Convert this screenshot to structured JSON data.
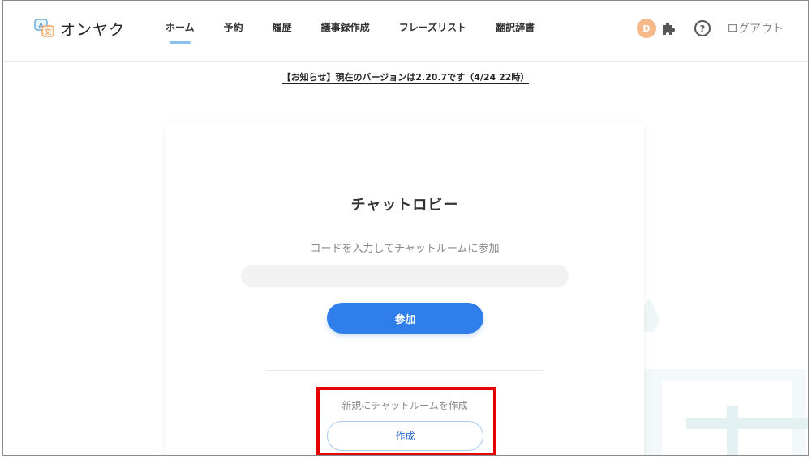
{
  "app": {
    "name": "オンヤク"
  },
  "nav": {
    "items": [
      {
        "label": "ホーム",
        "active": true
      },
      {
        "label": "予約"
      },
      {
        "label": "履歴"
      },
      {
        "label": "議事録作成"
      },
      {
        "label": "フレーズリスト"
      },
      {
        "label": "翻訳辞書"
      }
    ]
  },
  "header": {
    "avatar_initial": "D",
    "help_symbol": "?",
    "logout_label": "ログアウト"
  },
  "notice": {
    "text": "【お知らせ】現在のバージョンは2.20.7です（4/24 22時）"
  },
  "lobby": {
    "title": "チャットロビー",
    "code_prompt": "コードを入力してチャットルームに参加",
    "code_value": "",
    "join_label": "参加",
    "new_room_label": "新規にチャットルームを作成",
    "create_label": "作成"
  },
  "colors": {
    "primary": "#2f7eea",
    "avatar": "#f5b98a",
    "highlight": "#e60000"
  }
}
